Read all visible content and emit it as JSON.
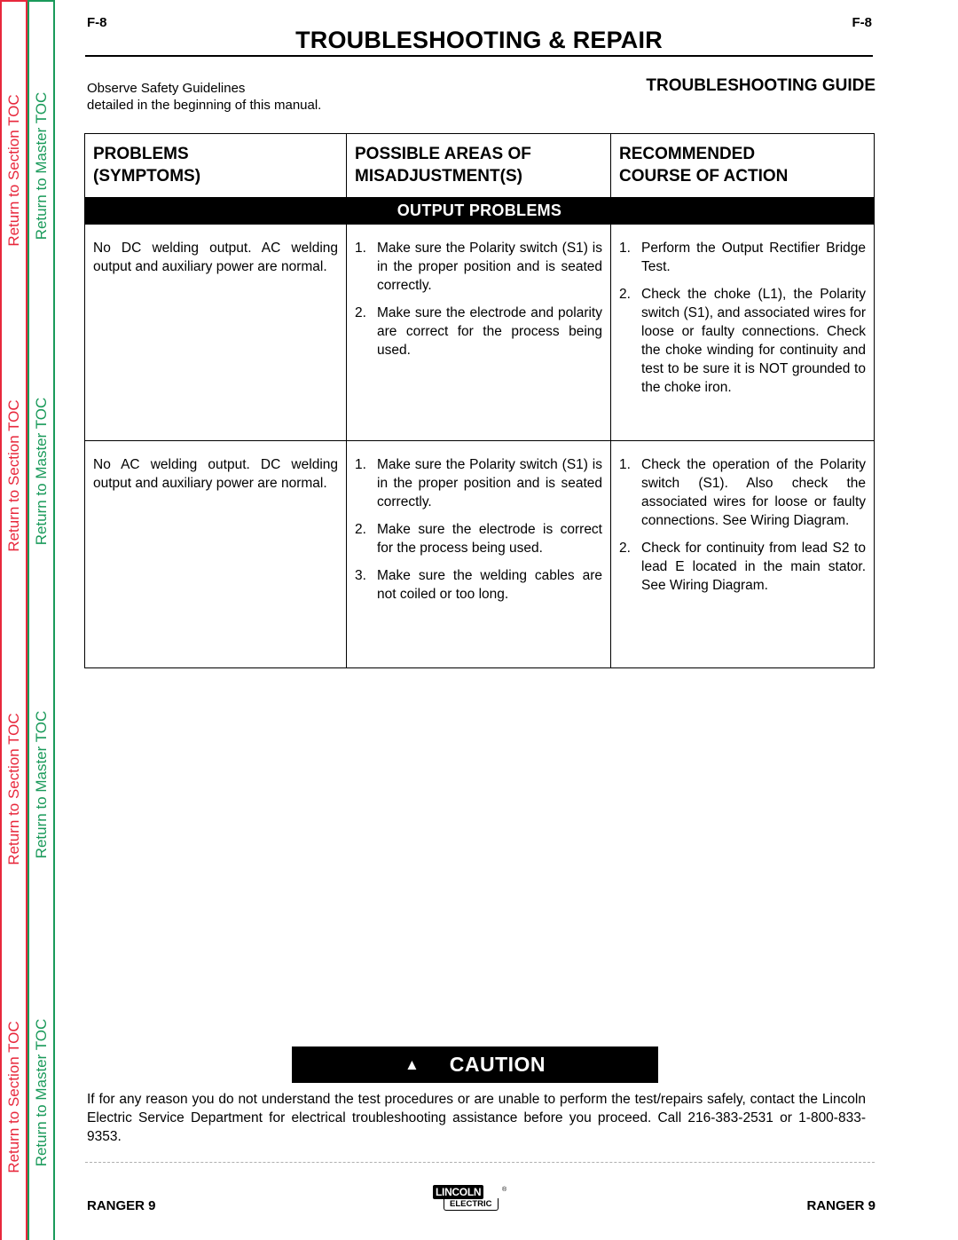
{
  "sidebar": {
    "section_toc_label": "Return to Section TOC",
    "master_toc_label": "Return to Master TOC",
    "colors": {
      "section": "#e8283c",
      "master": "#1a9a5a"
    }
  },
  "header": {
    "page_number_left": "F-8",
    "page_number_right": "F-8",
    "title": "TROUBLESHOOTING & REPAIR",
    "safety_line1": "Observe Safety Guidelines",
    "safety_line2": "detailed in the beginning of this manual.",
    "guide_title": "TROUBLESHOOTING GUIDE"
  },
  "table": {
    "columns": [
      {
        "line1": "PROBLEMS",
        "line2": "(SYMPTOMS)"
      },
      {
        "line1": "POSSIBLE AREAS OF",
        "line2": "MISADJUSTMENT(S)"
      },
      {
        "line1": "RECOMMENDED",
        "line2": "COURSE OF ACTION"
      }
    ],
    "section_label": "OUTPUT PROBLEMS",
    "rows": [
      {
        "symptom": "No DC welding output.  AC welding output and auxiliary power are normal.",
        "misadjustments": [
          {
            "num": "1.",
            "text": "Make sure the Polarity switch (S1) is in the proper position and is seated correctly."
          },
          {
            "num": "2.",
            "text": "Make sure the electrode and polarity are correct for the process being used."
          }
        ],
        "actions": [
          {
            "num": "1.",
            "text": "Perform the Output Rectifier Bridge Test."
          },
          {
            "num": "2.",
            "text": "Check the choke (L1), the Polarity switch (S1), and associated wires for loose or faulty connections.  Check the choke winding for continuity and test to be sure it is NOT grounded to the choke iron."
          }
        ]
      },
      {
        "symptom": "No AC welding output.  DC welding output and auxiliary power are normal.",
        "misadjustments": [
          {
            "num": "1.",
            "text": "Make sure the Polarity switch (S1) is in the proper position and is seated correctly."
          },
          {
            "num": "2.",
            "text": "Make sure the electrode is correct for the process being used."
          },
          {
            "num": "3.",
            "text": "Make sure the welding cables are not coiled or too long."
          }
        ],
        "actions": [
          {
            "num": "1.",
            "text": "Check the operation of the Polarity switch (S1).  Also check the associated wires for loose or faulty connections.  See Wiring Diagram."
          },
          {
            "num": "2.",
            "text": "Check for continuity from lead S2 to lead E located in the main stator.  See Wiring Diagram."
          }
        ]
      }
    ]
  },
  "caution": {
    "icon": "warning-triangle-icon",
    "label": "CAUTION",
    "text": "If for any reason you do not understand the test procedures or are unable to perform the test/repairs safely, contact the Lincoln Electric Service Department for electrical troubleshooting assistance before you proceed.  Call 216-383-2531 or 1-800-833-9353."
  },
  "footer": {
    "model_left": "RANGER 9",
    "model_right": "RANGER 9",
    "logo_top": "LINCOLN",
    "logo_bottom": "ELECTRIC",
    "logo_reg": "®"
  }
}
